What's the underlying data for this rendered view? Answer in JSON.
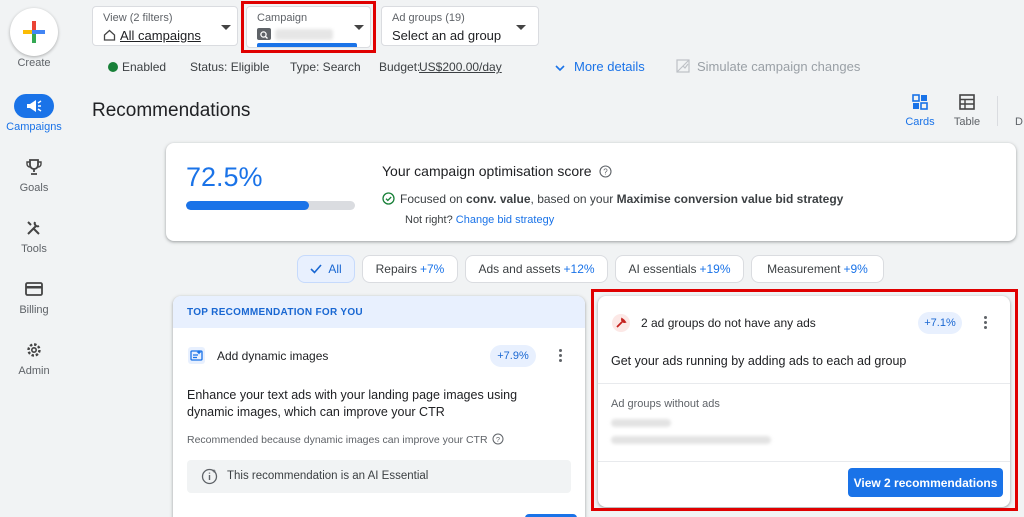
{
  "rail": {
    "create": "Create",
    "items": [
      {
        "label": "Campaigns",
        "icon": "megaphone-icon",
        "active": true
      },
      {
        "label": "Goals",
        "icon": "trophy-icon"
      },
      {
        "label": "Tools",
        "icon": "tools-icon"
      },
      {
        "label": "Billing",
        "icon": "credit-card-icon"
      },
      {
        "label": "Admin",
        "icon": "gear-icon"
      }
    ]
  },
  "selectors": {
    "view": {
      "small": "View (2 filters)",
      "value": "All campaigns"
    },
    "campaign": {
      "small": "Campaign"
    },
    "ad_groups": {
      "small": "Ad groups (19)",
      "value": "Select an ad group"
    }
  },
  "status": {
    "enabled": "Enabled",
    "status": "Status: Eligible",
    "type": "Type: Search",
    "budget_label": "Budget:",
    "budget_value": "US$200.00/day",
    "more_details": "More details",
    "simulate": "Simulate campaign changes"
  },
  "page": {
    "title": "Recommendations",
    "views": [
      "Cards",
      "Table",
      "D"
    ]
  },
  "score_card": {
    "score": "72.5%",
    "score_fraction": 0.725,
    "title": "Your campaign optimisation score",
    "focus_pre": "Focused on ",
    "focus_bold1": "conv. value",
    "focus_mid": ", based on your ",
    "focus_bold2": "Maximise conversion value bid strategy",
    "not_right": "Not right?",
    "change_link": "Change bid strategy"
  },
  "chips": [
    {
      "label": "All",
      "pct": "",
      "active": true
    },
    {
      "label": "Repairs",
      "pct": "+7%"
    },
    {
      "label": "Ads and assets",
      "pct": "+12%"
    },
    {
      "label": "AI essentials",
      "pct": "+19%"
    },
    {
      "label": "Measurement",
      "pct": "+9%"
    }
  ],
  "left_card": {
    "banner": "TOP RECOMMENDATION FOR YOU",
    "title": "Add dynamic images",
    "pct": "+7.9%",
    "body": "Enhance your text ads with your landing page images using dynamic images, which can improve your CTR",
    "reason": "Recommended because dynamic images can improve your CTR",
    "ai_note": "This recommendation is an AI Essential"
  },
  "right_card": {
    "title": "2 ad groups do not have any ads",
    "pct": "+7.1%",
    "subtitle": "Get your ads running by adding ads to each ad group",
    "section_label": "Ad groups without ads",
    "button": "View 2 recommendations"
  },
  "colors": {
    "accent": "#1a73e8",
    "highlight": "#e00000",
    "enabled": "#188038"
  }
}
